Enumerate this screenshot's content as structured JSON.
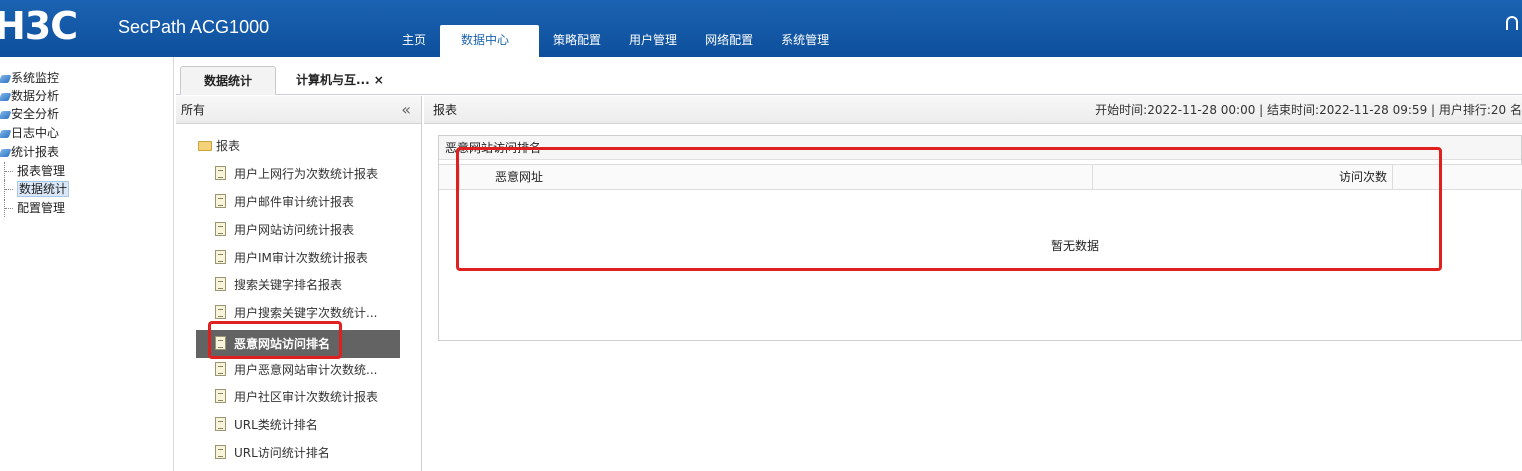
{
  "header": {
    "logo": "H3C",
    "product": "SecPath ACG1000",
    "nav": [
      {
        "label": "主页"
      },
      {
        "label": "数据中心"
      },
      {
        "label": "策略配置"
      },
      {
        "label": "用户管理"
      },
      {
        "label": "网络配置"
      },
      {
        "label": "系统管理"
      }
    ],
    "active_nav": "数据中心"
  },
  "left_tree": {
    "items": [
      "系统监控",
      "数据分析",
      "安全分析",
      "日志中心",
      "统计报表"
    ],
    "children": [
      "报表管理",
      "数据统计",
      "配置管理"
    ],
    "selected_child": "数据统计"
  },
  "tabs": {
    "active": "数据统计",
    "second": "计算机与互...",
    "close": "×"
  },
  "report_list": {
    "header": "所有",
    "collapse": "«",
    "folder": "报表",
    "items": [
      "用户上网行为次数统计报表",
      "用户邮件审计统计报表",
      "用户网站访问统计报表",
      "用户IM审计次数统计报表",
      "搜索关键字排名报表",
      "用户搜索关键字次数统计...",
      "恶意网站访问排名",
      "用户恶意网站审计次数统...",
      "用户社区审计次数统计报表",
      "URL类统计排名",
      "URL访问统计排名"
    ],
    "selected": "恶意网站访问排名"
  },
  "content": {
    "header": "报表",
    "meta": "开始时间:2022-11-28 00:00 | 结束时间:2022-11-28 09:59 | 用户排行:20 名",
    "box_title": "恶意网站访问排名",
    "columns": [
      "恶意网址",
      "访问次数"
    ],
    "empty_text": "暂无数据"
  },
  "colors": {
    "header_blue": "#1b63b2",
    "selected_row": "#636363",
    "annotation_red": "#e0201e"
  }
}
